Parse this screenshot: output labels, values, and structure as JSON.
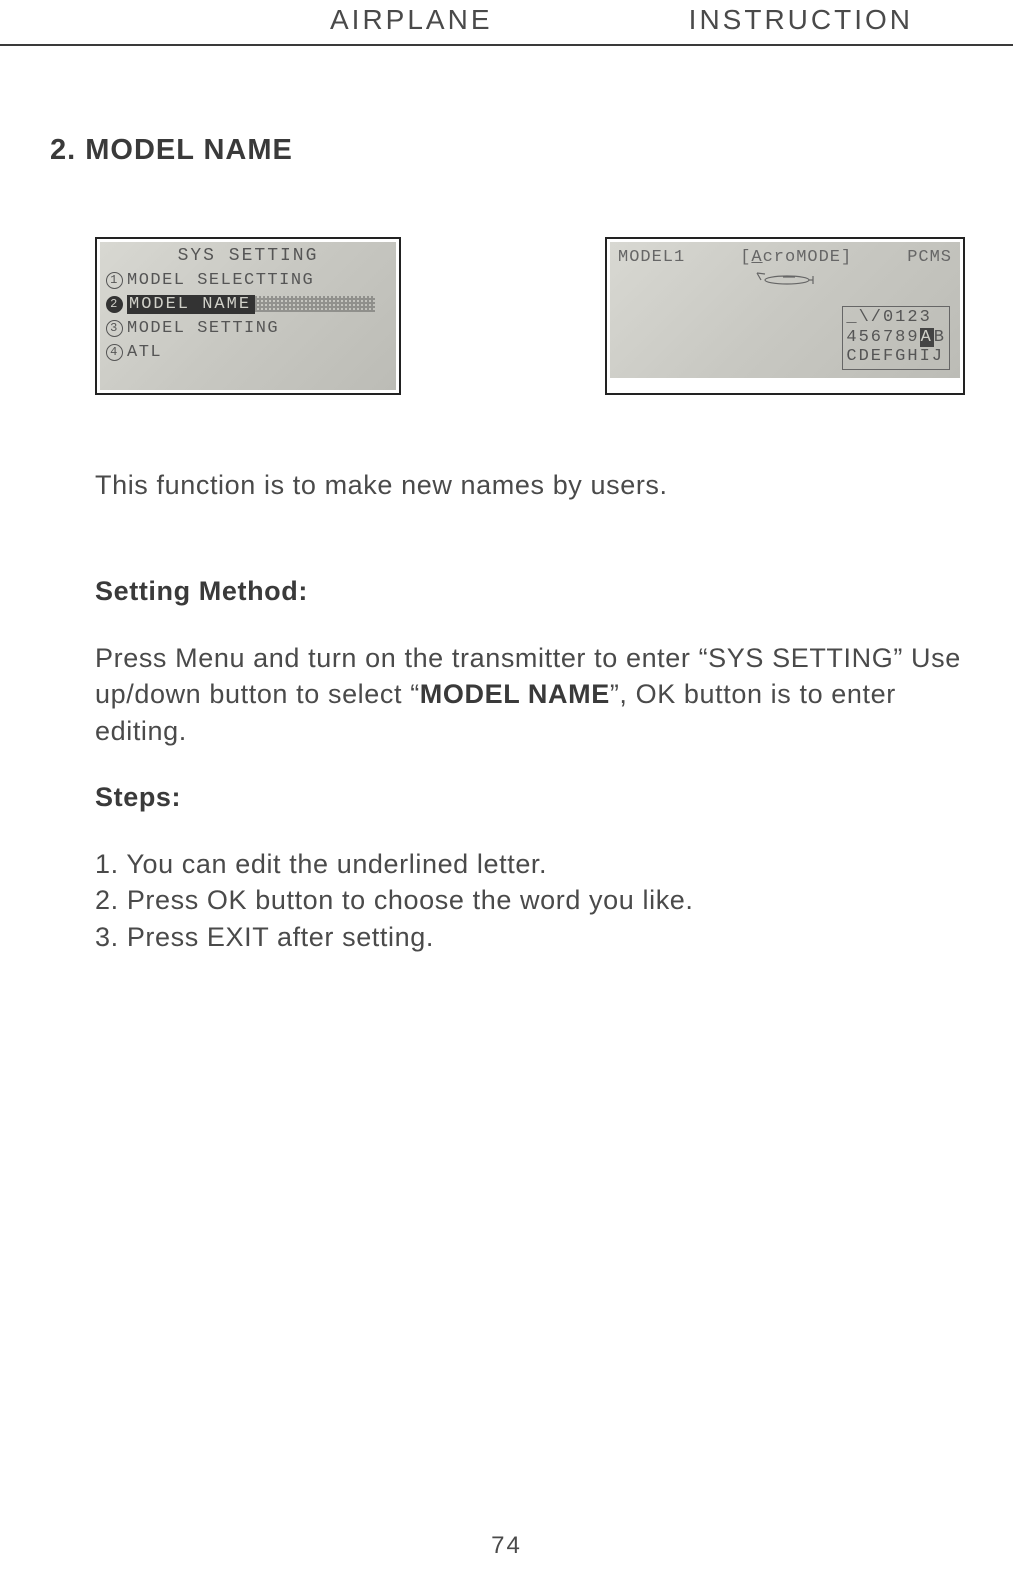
{
  "header": {
    "left": "AIRPLANE",
    "right": "INSTRUCTION"
  },
  "section_title": "2. MODEL NAME",
  "lcd1": {
    "title": "SYS SETTING",
    "items": [
      {
        "n": "1",
        "label": "MODEL SELECTTING",
        "selected": false
      },
      {
        "n": "2",
        "label": "MODEL NAME",
        "selected": true
      },
      {
        "n": "3",
        "label": "MODEL SETTING",
        "selected": false
      },
      {
        "n": "4",
        "label": "ATL",
        "selected": false
      }
    ]
  },
  "lcd2": {
    "left": "MODEL1",
    "mid_prefix": "[",
    "mid_under": "A",
    "mid_rest": "croMODE]",
    "right": "PCMS",
    "chars": {
      "row1": "_\\/0123",
      "row2a": "456789",
      "row2hl": "A",
      "row2b": "B",
      "row3": "CDEFGHIJ"
    }
  },
  "intro": "This function is to make new names by users.",
  "sub": "Setting Method:",
  "para_a": "Press Menu and turn on the transmitter to enter “SYS SETTING” Use up/down button to select “",
  "para_bold": "MODEL NAME",
  "para_b": "”, OK button is to enter editing.",
  "steps_h": "Steps:",
  "steps": [
    "1. You can edit the underlined letter.",
    "2. Press OK button to choose the word you like.",
    "3. Press EXIT after setting."
  ],
  "page": "74"
}
